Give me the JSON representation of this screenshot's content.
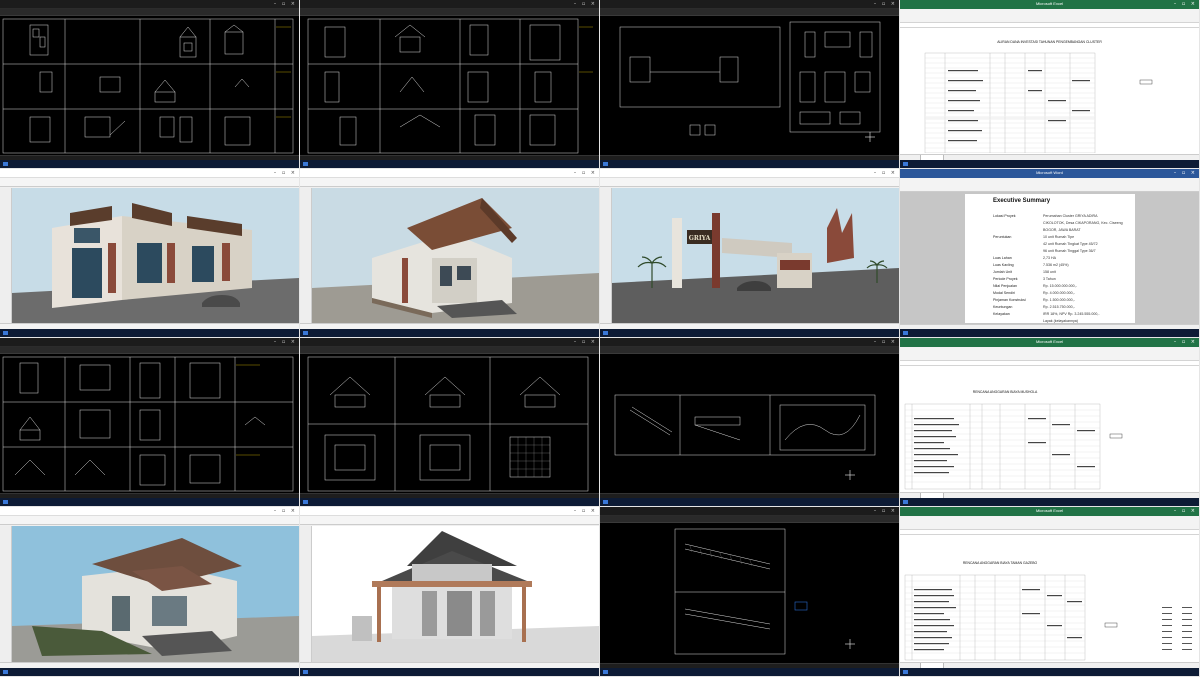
{
  "windows": [
    {
      "type": "cad"
    },
    {
      "type": "cad"
    },
    {
      "type": "cad"
    },
    {
      "type": "excel",
      "title": "Microsoft Excel",
      "heading": "ALIRAN DANA INVESTASI TAHUNAN PENGEMBANGAN CLUSTER"
    },
    {
      "type": "sketchup"
    },
    {
      "type": "sketchup"
    },
    {
      "type": "sketchup"
    },
    {
      "type": "word",
      "title": "Microsoft Word",
      "heading": "Executive Summary"
    },
    {
      "type": "cad"
    },
    {
      "type": "cad"
    },
    {
      "type": "cad"
    },
    {
      "type": "excel",
      "title": "Microsoft Excel",
      "heading": "RENCANA ANGGARAN BIAYA MUSHOLA"
    },
    {
      "type": "sketchup"
    },
    {
      "type": "sketchup"
    },
    {
      "type": "cad"
    },
    {
      "type": "excel",
      "title": "Microsoft Excel",
      "heading": "RENCANA ANGGARAN BIAYA TAMAN GAZEBO"
    }
  ],
  "signboard": {
    "text": "GRIYA"
  },
  "summary": {
    "heading": "Executive Summary",
    "rows": [
      {
        "k": "Lokasi Proyek",
        "v": "Perumahan Cluster GRIYA ADIRA"
      },
      {
        "k": "",
        "v": "CIKOLOTOK, Desa CIKAPORANG, Kec. Ciseeng"
      },
      {
        "k": "",
        "v": "BOGOR, JAWA BARAT"
      },
      {
        "k": "Peruntukan",
        "v": "10 unit Rumah Tipe"
      },
      {
        "k": "",
        "v": "42 unit Rumah Tingkat Type 45/72"
      },
      {
        "k": "",
        "v": "96 unit Rumah Tinggal Type 36/7"
      },
      {
        "k": "Luas Lahan",
        "v": "2,73 HA"
      },
      {
        "k": "Luas Kavling",
        "v": "7.536 m2 (45%)"
      },
      {
        "k": "Jumlah Unit",
        "v": "158 unit"
      },
      {
        "k": "Periode Proyek",
        "v": "3 Tahun"
      },
      {
        "k": "Nilai Penjualan",
        "v": "Rp. 15.000.000.000,-"
      },
      {
        "k": "Modal Sendiri",
        "v": "Rp. 4.000.000.000,-"
      },
      {
        "k": "Pinjaman Konstruksi",
        "v": "Rp. 1.500.000.000,-"
      },
      {
        "k": "Keuntungan",
        "v": "Rp. 2.515.750.000,-"
      },
      {
        "k": "Kelayakan",
        "v": "IRR 18%, NPV Rp. 3.245.555.000,-"
      },
      {
        "k": "",
        "v": "Layak (kelayakannya)"
      }
    ]
  },
  "colors": {
    "cad_bg": "#000000",
    "excel": "#217346",
    "word": "#2b579a",
    "sketchup_sky": "#c8dde8"
  }
}
